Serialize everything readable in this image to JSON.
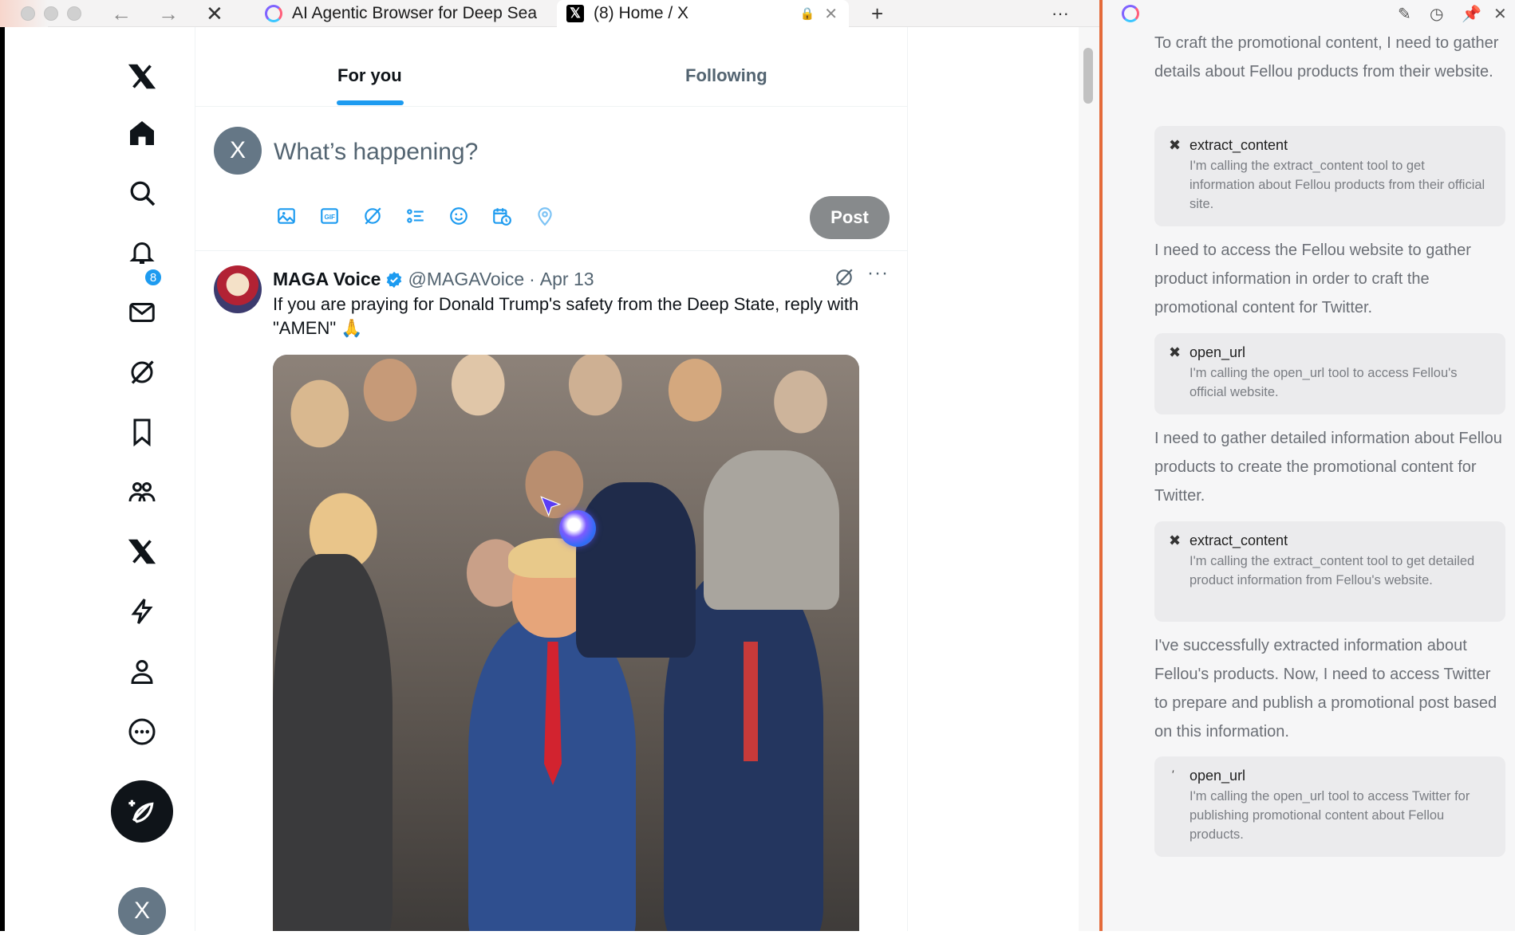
{
  "browser": {
    "tabs": [
      {
        "title": "AI Agentic Browser for Deep Sea"
      },
      {
        "title": "(8) Home / X"
      }
    ],
    "new_tab_label": "+",
    "menu_label": "···"
  },
  "nav": {
    "notifications_badge": "8",
    "avatar_letter": "X"
  },
  "timeline": {
    "tab_for_you": "For you",
    "tab_following": "Following",
    "composer": {
      "avatar_letter": "X",
      "placeholder": "What’s happening?",
      "post_label": "Post"
    },
    "tweet": {
      "name": "MAGA Voice",
      "handle": "@MAGAVoice",
      "separator": "·",
      "date": "Apr 13",
      "text": "If you are praying for Donald Trump's safety from the Deep State, reply with \"AMEN\" 🙏",
      "more": "···"
    }
  },
  "agent": {
    "intro_text": "To craft the promotional content, I need to gather details about Fellou products from their website.",
    "steps": [
      {
        "tool": "extract_content",
        "desc": "I'm calling the extract_content tool to get information about Fellou products from their official site."
      },
      {
        "text": "I need to access the Fellou website to gather product information in order to craft the promotional content for Twitter."
      },
      {
        "tool": "open_url",
        "desc": "I'm calling the open_url tool to access Fellou's official website."
      },
      {
        "text": "I need to gather detailed information about Fellou products to create the promotional content for Twitter."
      },
      {
        "tool": "extract_content",
        "desc": "I'm calling the extract_content tool to get detailed product information from Fellou's website."
      },
      {
        "text": "I've successfully extracted information about Fellou's products. Now, I need to access Twitter to prepare and publish a promotional post based on this information."
      },
      {
        "tool": "open_url",
        "desc": "I'm calling the open_url tool to access Twitter for publishing promotional content about Fellou products."
      }
    ]
  },
  "colors": {
    "accent": "#1d9bf0",
    "post_button": "#878a8c",
    "divider": "#e46a3a"
  }
}
